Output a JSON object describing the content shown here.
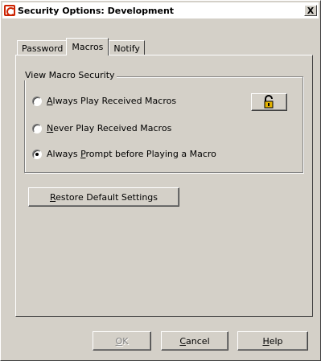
{
  "window": {
    "title": "Security Options: Development",
    "close_label": "X"
  },
  "tabs": [
    {
      "label": "Password"
    },
    {
      "label": "Macros"
    },
    {
      "label": "Notify"
    }
  ],
  "macro_group": {
    "legend": "View Macro Security",
    "options": [
      {
        "mnemonic": "A",
        "rest": "lways Play Received Macros",
        "checked": false
      },
      {
        "mnemonic": "N",
        "rest": "ever Play Received Macros",
        "checked": false
      },
      {
        "pre": "Always ",
        "mnemonic": "P",
        "rest": "rompt before Playing a Macro",
        "checked": true
      }
    ],
    "lock_icon": "padlock-icon"
  },
  "restore_button": {
    "mnemonic": "R",
    "rest": "estore Default Settings"
  },
  "footer": {
    "ok": {
      "mnemonic": "O",
      "rest": "K",
      "enabled": false
    },
    "cancel": {
      "mnemonic": "C",
      "rest": "ancel"
    },
    "help": {
      "mnemonic": "H",
      "rest": "elp"
    }
  },
  "colors": {
    "face": "#d4d0c8",
    "lock_body": "#e0b000"
  }
}
